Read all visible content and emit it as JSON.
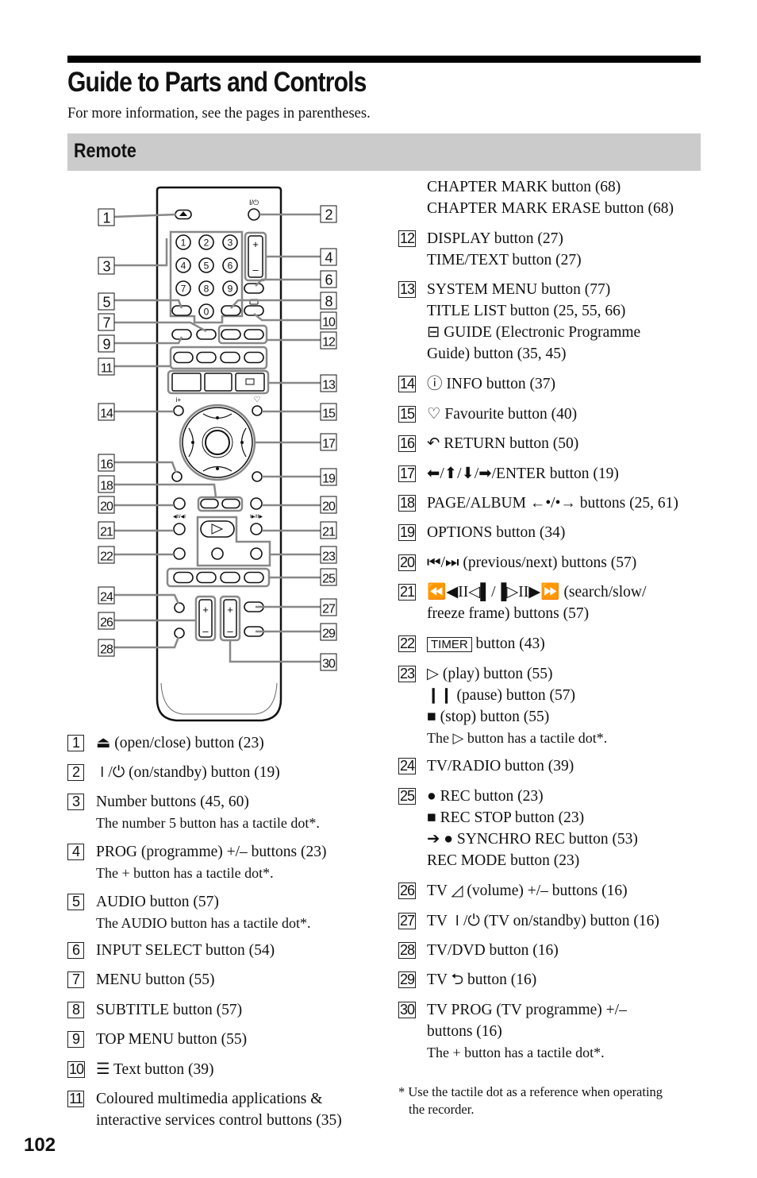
{
  "page": {
    "title": "Guide to Parts and Controls",
    "intro": "For more information, see the pages in parentheses.",
    "section": "Remote",
    "page_number": "102"
  },
  "remote_callouts": [
    "1",
    "2",
    "3",
    "4",
    "5",
    "6",
    "7",
    "8",
    "9",
    "10",
    "11",
    "12",
    "13",
    "14",
    "15",
    "16",
    "17",
    "18",
    "19",
    "20",
    "20",
    "21",
    "21",
    "22",
    "23",
    "24",
    "25",
    "26",
    "27",
    "28",
    "29",
    "30"
  ],
  "remote_labels": {
    "keypad": [
      "1",
      "2",
      "3",
      "4",
      "5",
      "6",
      "7",
      "8",
      "9",
      "0"
    ],
    "power": "I/⏻",
    "plus": "+",
    "minus": "–"
  },
  "left_items": [
    {
      "num": "1",
      "lines": [
        "⏏ (open/close) button (23)"
      ]
    },
    {
      "num": "2",
      "lines": [
        "⏽/⏻ (on/standby) button (19)"
      ]
    },
    {
      "num": "3",
      "lines": [
        "Number buttons (45, 60)"
      ],
      "note": "The number 5 button has a tactile dot*."
    },
    {
      "num": "4",
      "lines": [
        "PROG (programme) +/– buttons (23)"
      ],
      "note": "The + button has a tactile dot*."
    },
    {
      "num": "5",
      "lines": [
        "AUDIO button (57)"
      ],
      "note": "The AUDIO button has a tactile dot*."
    },
    {
      "num": "6",
      "lines": [
        "INPUT SELECT button (54)"
      ]
    },
    {
      "num": "7",
      "lines": [
        "MENU button (55)"
      ]
    },
    {
      "num": "8",
      "lines": [
        "SUBTITLE button (57)"
      ]
    },
    {
      "num": "9",
      "lines": [
        "TOP MENU button (55)"
      ]
    },
    {
      "num": "10",
      "lines": [
        "☰ Text button (39)"
      ]
    },
    {
      "num": "11",
      "lines": [
        "Coloured multimedia applications &",
        "interactive services control buttons (35)"
      ]
    }
  ],
  "right_continuation": [
    "CHAPTER MARK button (68)",
    "CHAPTER MARK ERASE button (68)"
  ],
  "right_items": [
    {
      "num": "12",
      "lines": [
        "DISPLAY button (27)",
        "TIME/TEXT button (27)"
      ]
    },
    {
      "num": "13",
      "lines": [
        "SYSTEM MENU button (77)",
        "TITLE LIST button (25, 55, 66)",
        "⊟ GUIDE (Electronic Programme",
        "Guide) button (35, 45)"
      ]
    },
    {
      "num": "14",
      "lines": [
        "ⓘ INFO button (37)"
      ]
    },
    {
      "num": "15",
      "lines": [
        "♡ Favourite button (40)"
      ]
    },
    {
      "num": "16",
      "lines": [
        "↶ RETURN button (50)"
      ]
    },
    {
      "num": "17",
      "lines": [
        "⬅/⬆/⬇/➡/ENTER button (19)"
      ]
    },
    {
      "num": "18",
      "lines": [
        "PAGE/ALBUM ←•/•→ buttons (25, 61)"
      ]
    },
    {
      "num": "19",
      "lines": [
        "OPTIONS button (34)"
      ]
    },
    {
      "num": "20",
      "lines": [
        "⏮/⏭ (previous/next) buttons (57)"
      ]
    },
    {
      "num": "21",
      "lines": [
        "⏪◀II◁▌/▐▷II▶⏩ (search/slow/",
        "freeze frame) buttons (57)"
      ]
    },
    {
      "num": "22",
      "lines": [
        "TIMER button (43)"
      ],
      "boxed_prefix": "TIMER",
      "rest": " button (43)"
    },
    {
      "num": "23",
      "lines": [
        "▷ (play) button (55)",
        "❙❙ (pause) button (57)",
        "■ (stop) button (55)"
      ],
      "note": "The ▷ button has a tactile dot*."
    },
    {
      "num": "24",
      "lines": [
        "TV/RADIO button (39)"
      ]
    },
    {
      "num": "25",
      "lines": [
        "● REC button (23)",
        "■ REC STOP button (23)",
        "➔ ● SYNCHRO REC button (53)",
        "REC MODE button (23)"
      ]
    },
    {
      "num": "26",
      "lines": [
        "TV ◿ (volume) +/– buttons (16)"
      ]
    },
    {
      "num": "27",
      "lines": [
        "TV ⏽/⏻ (TV on/standby) button (16)"
      ]
    },
    {
      "num": "28",
      "lines": [
        "TV/DVD button (16)"
      ]
    },
    {
      "num": "29",
      "lines": [
        "TV ⮌ button (16)"
      ]
    },
    {
      "num": "30",
      "lines": [
        "TV PROG (TV programme) +/–",
        "buttons (16)"
      ],
      "note": "The + button has a tactile dot*."
    }
  ],
  "footnote": [
    "* Use the tactile dot as a reference when operating",
    "the recorder."
  ]
}
